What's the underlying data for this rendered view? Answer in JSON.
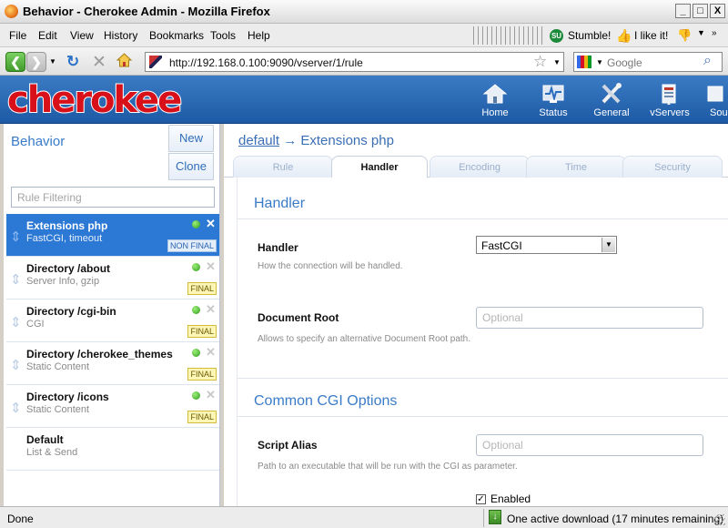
{
  "window": {
    "title": "Behavior - Cherokee Admin - Mozilla Firefox",
    "min_label": "_",
    "max_label": "□",
    "close_label": "X"
  },
  "menubar": {
    "items": [
      "File",
      "Edit",
      "View",
      "History",
      "Bookmarks",
      "Tools",
      "Help"
    ],
    "stumble_label": "Stumble!",
    "like_label": "I like it!"
  },
  "navbar": {
    "url": "http://192.168.0.100:9090/vserver/1/rule",
    "search_placeholder": "Google"
  },
  "app": {
    "logo": "cherokee",
    "nav": [
      {
        "label": "Home",
        "icon": "home-icon"
      },
      {
        "label": "Status",
        "icon": "status-icon"
      },
      {
        "label": "General",
        "icon": "tools-icon"
      },
      {
        "label": "vServers",
        "icon": "vservers-icon"
      },
      {
        "label": "Sou",
        "icon": "sources-icon"
      }
    ]
  },
  "left": {
    "title": "Behavior",
    "new_label": "New",
    "clone_label": "Clone",
    "filter_placeholder": "Rule Filtering",
    "rules": [
      {
        "name": "Extensions php",
        "sub": "FastCGI, timeout",
        "badge": "NON FINAL",
        "selected": true
      },
      {
        "name": "Directory /about",
        "sub": "Server Info, gzip",
        "badge": "FINAL",
        "selected": false
      },
      {
        "name": "Directory /cgi-bin",
        "sub": "CGI",
        "badge": "FINAL",
        "selected": false
      },
      {
        "name": "Directory /cherokee_themes",
        "sub": "Static Content",
        "badge": "FINAL",
        "selected": false
      },
      {
        "name": "Directory /icons",
        "sub": "Static Content",
        "badge": "FINAL",
        "selected": false
      },
      {
        "name": "Default",
        "sub": "List & Send",
        "badge": "",
        "selected": false
      }
    ]
  },
  "right": {
    "breadcrumb_link": "default",
    "breadcrumb_rest": " → Extensions php",
    "tabs": [
      "Rule",
      "Handler",
      "Encoding",
      "Time",
      "Security"
    ],
    "active_tab": "Handler",
    "handler_section": "Handler",
    "handler_label": "Handler",
    "handler_value": "FastCGI",
    "handler_help": "How the connection will be handled.",
    "docroot_label": "Document Root",
    "docroot_placeholder": "Optional",
    "docroot_help": "Allows to specify an alternative Document Root path.",
    "cgi_section": "Common CGI Options",
    "alias_label": "Script Alias",
    "alias_placeholder": "Optional",
    "alias_help": "Path to an executable that will be run with the CGI as parameter.",
    "enabled_label": "Enabled"
  },
  "status": {
    "left": "Done",
    "download": "One active download (17 minutes remaining)"
  }
}
